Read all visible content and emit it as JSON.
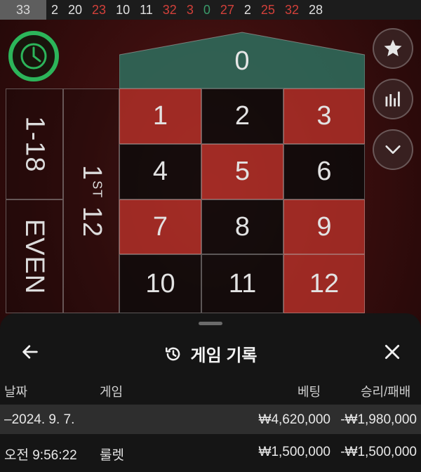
{
  "history_strip": {
    "numbers": [
      {
        "value": "33",
        "color": "first"
      },
      {
        "value": "2",
        "color": "black"
      },
      {
        "value": "20",
        "color": "black"
      },
      {
        "value": "23",
        "color": "red"
      },
      {
        "value": "10",
        "color": "black"
      },
      {
        "value": "11",
        "color": "black"
      },
      {
        "value": "32",
        "color": "red"
      },
      {
        "value": "3",
        "color": "red"
      },
      {
        "value": "0",
        "color": "green"
      },
      {
        "value": "27",
        "color": "red"
      },
      {
        "value": "2",
        "color": "black"
      },
      {
        "value": "25",
        "color": "red"
      },
      {
        "value": "32",
        "color": "red"
      },
      {
        "value": "28",
        "color": "black"
      }
    ]
  },
  "table": {
    "zero": "0",
    "cells": [
      {
        "n": "1",
        "color": "red"
      },
      {
        "n": "2",
        "color": "black"
      },
      {
        "n": "3",
        "color": "red"
      },
      {
        "n": "4",
        "color": "black"
      },
      {
        "n": "5",
        "color": "red"
      },
      {
        "n": "6",
        "color": "black"
      },
      {
        "n": "7",
        "color": "red"
      },
      {
        "n": "8",
        "color": "black"
      },
      {
        "n": "9",
        "color": "red"
      },
      {
        "n": "10",
        "color": "black"
      },
      {
        "n": "11",
        "color": "black"
      },
      {
        "n": "12",
        "color": "red"
      }
    ],
    "low_bet": "1-18",
    "even_bet": "EVEN",
    "dozen_main": "1",
    "dozen_sup": "ST",
    "dozen_rest": " 12"
  },
  "side_buttons": {
    "icons": [
      "star-icon",
      "stats-icon",
      "chevron-down-icon"
    ]
  },
  "panel": {
    "title": "게임 기록",
    "columns": {
      "date": "날짜",
      "game": "게임",
      "bet": "베팅",
      "result": "승리/패배"
    },
    "date_row": {
      "date": "–2024. 9. 7.",
      "bet": "₩4,620,000",
      "result": "-₩1,980,000"
    },
    "entries": [
      {
        "time": "오전 9:56:22",
        "game": "룰렛",
        "bet": "₩1,500,000",
        "result": "-₩1,500,000"
      }
    ]
  },
  "colors": {
    "timer_ring": "#2cb55a",
    "felt_green": "#2e6e5e",
    "roulette_red": "#b23028"
  }
}
